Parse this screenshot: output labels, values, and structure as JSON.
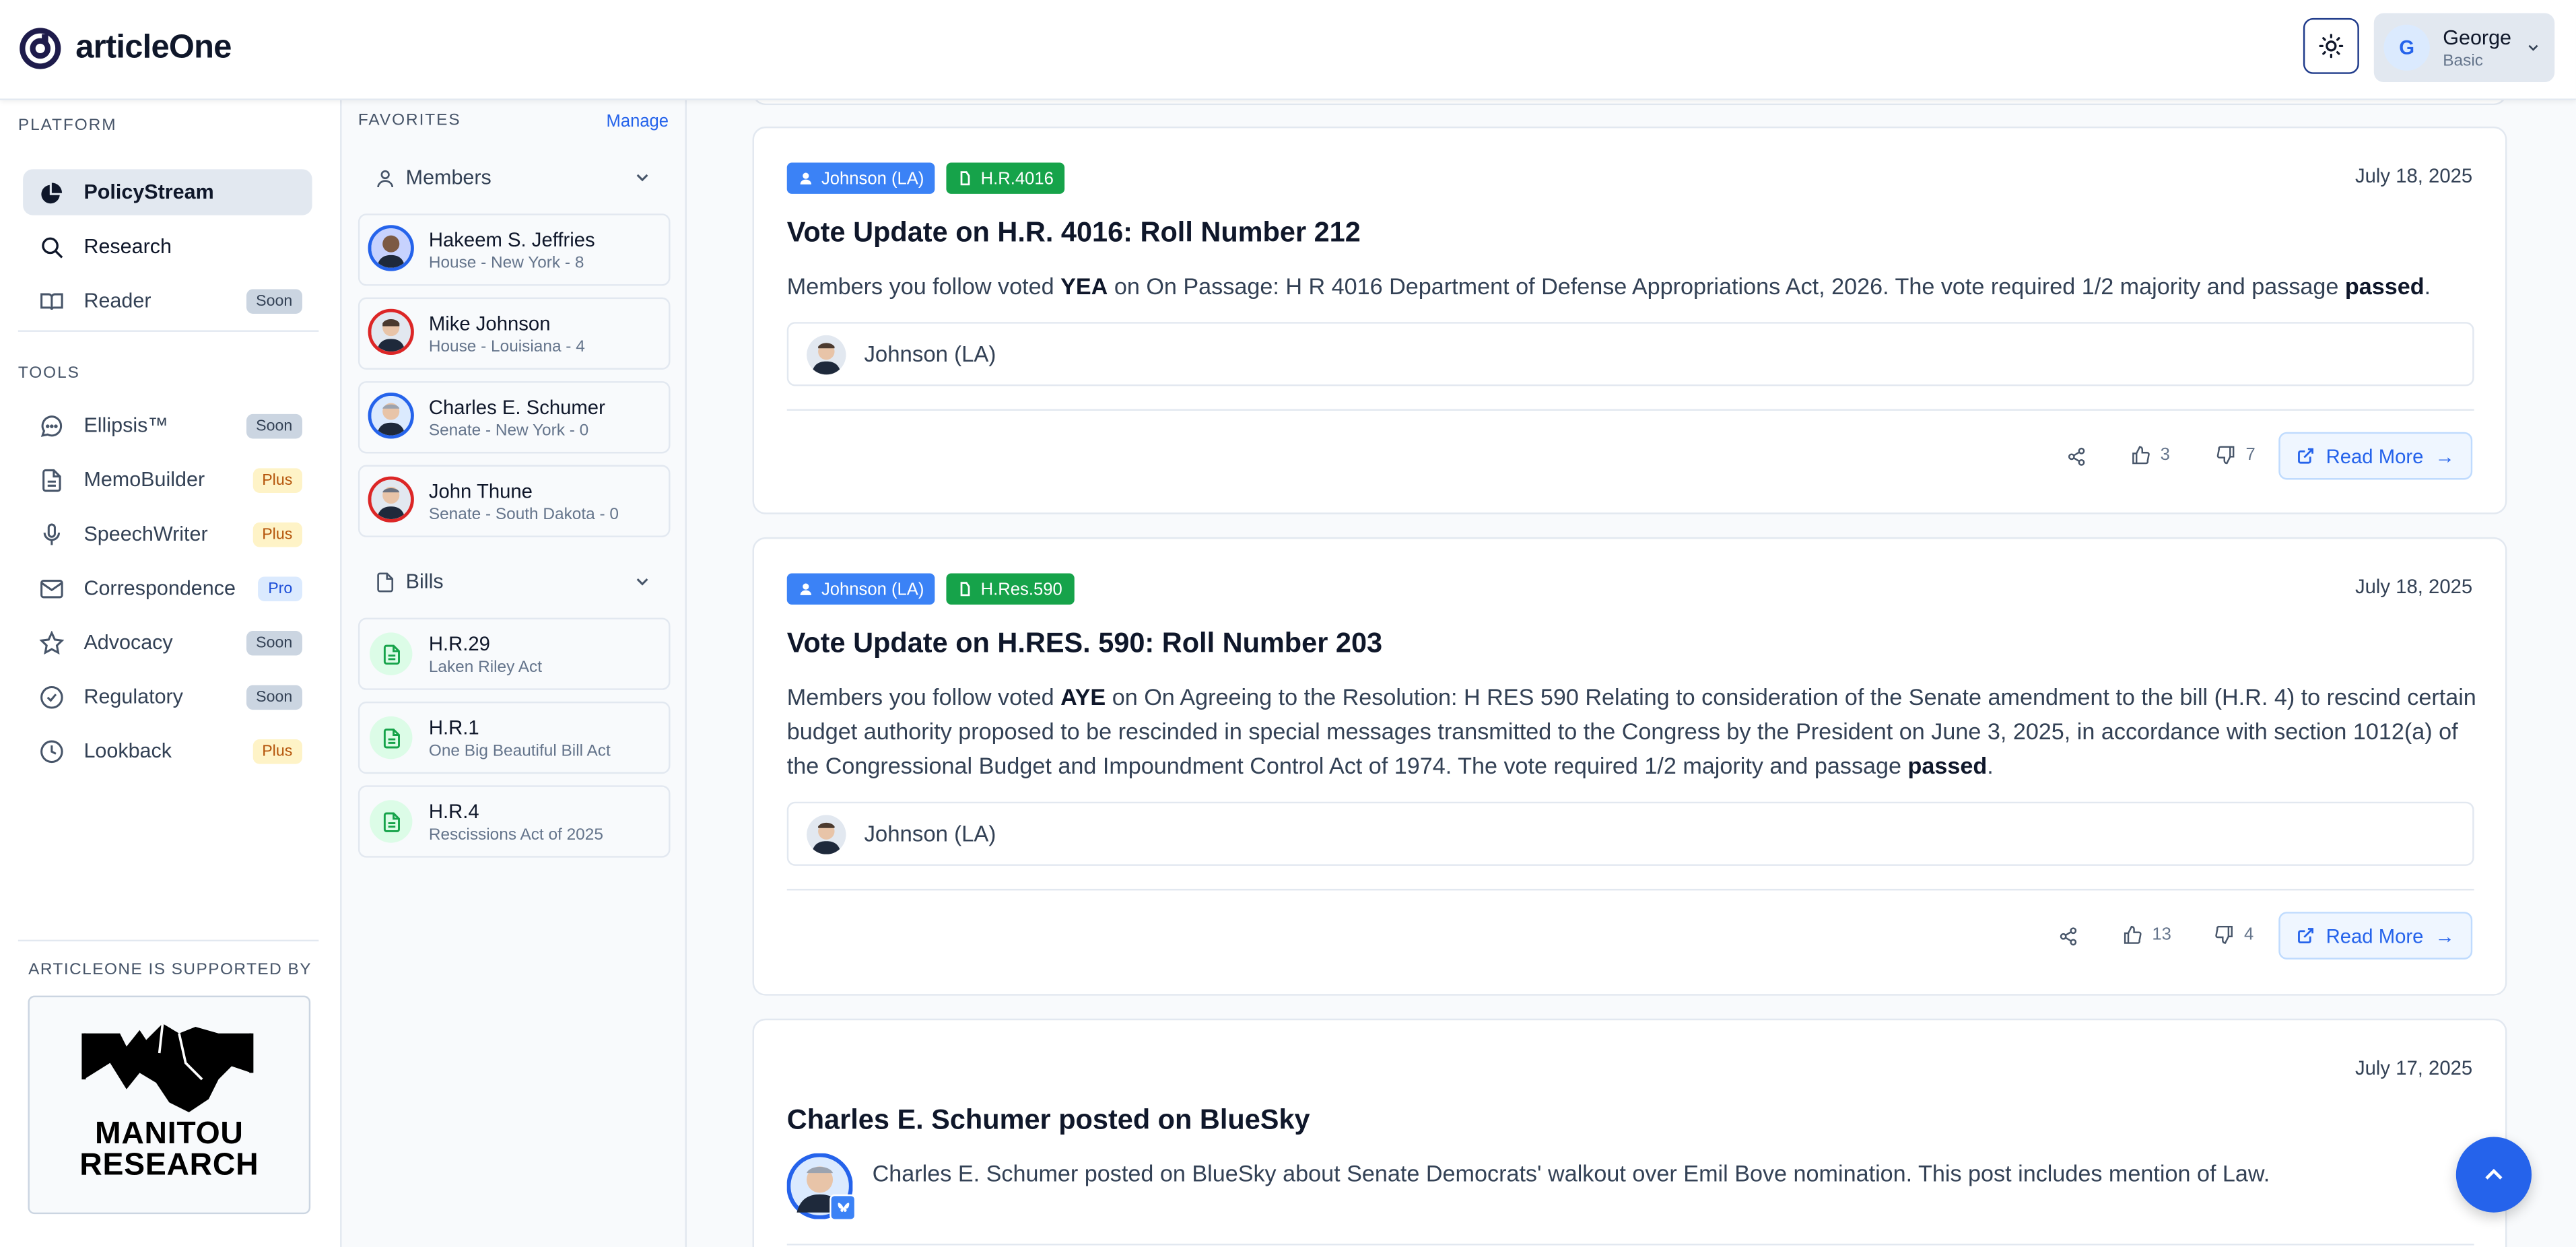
{
  "app": {
    "logo_text": "articleOne"
  },
  "header": {
    "user": {
      "initial": "G",
      "name": "George",
      "plan": "Basic"
    },
    "theme_icon": "sun-icon"
  },
  "sidebar": {
    "platform_label": "PLATFORM",
    "platform_items": [
      {
        "label": "PolicyStream",
        "icon": "pie-chart-icon",
        "badge": ""
      },
      {
        "label": "Research",
        "icon": "search-icon",
        "badge": ""
      },
      {
        "label": "Reader",
        "icon": "book-icon",
        "badge": "Soon"
      }
    ],
    "tools_label": "TOOLS",
    "tool_items": [
      {
        "label": "Ellipsis™",
        "icon": "chat-bubble-icon",
        "badge": "Soon"
      },
      {
        "label": "MemoBuilder",
        "icon": "document-icon",
        "badge": "Plus"
      },
      {
        "label": "SpeechWriter",
        "icon": "microphone-icon",
        "badge": "Plus"
      },
      {
        "label": "Correspondence",
        "icon": "mail-icon",
        "badge": "Pro"
      },
      {
        "label": "Advocacy",
        "icon": "star-icon",
        "badge": "Soon"
      },
      {
        "label": "Regulatory",
        "icon": "check-circle-icon",
        "badge": "Soon"
      },
      {
        "label": "Lookback",
        "icon": "clock-icon",
        "badge": "Plus"
      }
    ],
    "supported_by_label": "ARTICLEONE IS SUPPORTED BY",
    "sponsor": {
      "line1": "MANITOU",
      "line2": "RESEARCH"
    }
  },
  "favorites": {
    "title": "FAVORITES",
    "manage_label": "Manage",
    "members_label": "Members",
    "members": [
      {
        "name": "Hakeem S. Jeffries",
        "detail": "House - New York - 8",
        "party": "blue"
      },
      {
        "name": "Mike Johnson",
        "detail": "House - Louisiana - 4",
        "party": "red"
      },
      {
        "name": "Charles E. Schumer",
        "detail": "Senate - New York - 0",
        "party": "blue"
      },
      {
        "name": "John Thune",
        "detail": "Senate - South Dakota - 0",
        "party": "red"
      }
    ],
    "bills_label": "Bills",
    "bills": [
      {
        "id": "H.R.29",
        "title": "Laken Riley Act"
      },
      {
        "id": "H.R.1",
        "title": "One Big Beautiful Bill Act"
      },
      {
        "id": "H.R.4",
        "title": "Rescissions Act of 2025"
      }
    ]
  },
  "feed": {
    "cards": [
      {
        "member_tag": "Johnson (LA)",
        "bill_tag": "H.R.4016",
        "date": "July 18, 2025",
        "title": "Vote Update on H.R. 4016: Roll Number 212",
        "body_pre": "Members you follow voted ",
        "vote": "YEA",
        "body_mid": " on On Passage: H R 4016 Department of Defense Appropriations Act, 2026. The vote required 1/2 majority and passage ",
        "result": "passed",
        "body_end": ".",
        "member": "Johnson (LA)",
        "likes": "3",
        "dislikes": "7",
        "read_more": "Read More"
      },
      {
        "member_tag": "Johnson (LA)",
        "bill_tag": "H.Res.590",
        "date": "July 18, 2025",
        "title": "Vote Update on H.RES. 590: Roll Number 203",
        "body_pre": "Members you follow voted ",
        "vote": "AYE",
        "body_mid": " on On Agreeing to the Resolution: H RES 590 Relating to consideration of the Senate amendment to the bill (H.R. 4) to rescind certain budget authority proposed to be rescinded in special messages transmitted to the Congress by the President on June 3, 2025, in accordance with section 1012(a) of the Congressional Budget and Impoundment Control Act of 1974. The vote required 1/2 majority and passage ",
        "result": "passed",
        "body_end": ".",
        "member": "Johnson (LA)",
        "likes": "13",
        "dislikes": "4",
        "read_more": "Read More"
      },
      {
        "date": "July 17, 2025",
        "title": "Charles E. Schumer posted on BlueSky",
        "body": "Charles E. Schumer posted on BlueSky about Senate Democrats' walkout over Emil Bove nomination. This post includes mention of Law."
      }
    ]
  },
  "colors": {
    "accent": "#2563eb",
    "democrat": "#2563eb",
    "republican": "#dc2626",
    "bill_green": "#16a34a"
  }
}
